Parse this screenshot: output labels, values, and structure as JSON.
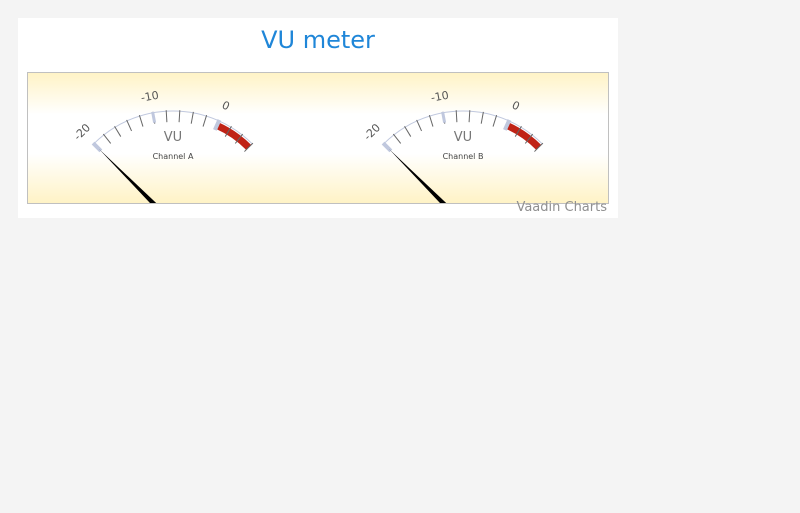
{
  "title": "VU meter",
  "credits": "Vaadin Charts",
  "colors": {
    "title": "#1f86d8",
    "needle": "#000000",
    "red_band": "#c02316",
    "arc": "#c0c8de",
    "tick": "#666666"
  },
  "chart_data": [
    {
      "type": "gauge",
      "pane_title": "VU",
      "series_name": "Channel A",
      "scale_min": -20,
      "scale_max": 6,
      "tick_labels": [
        "-20",
        "-10",
        "0"
      ],
      "plot_band": {
        "from": 0,
        "to": 6
      },
      "value": -20
    },
    {
      "type": "gauge",
      "pane_title": "VU",
      "series_name": "Channel B",
      "scale_min": -20,
      "scale_max": 6,
      "tick_labels": [
        "-20",
        "-10",
        "0"
      ],
      "plot_band": {
        "from": 0,
        "to": 6
      },
      "value": -20
    }
  ]
}
